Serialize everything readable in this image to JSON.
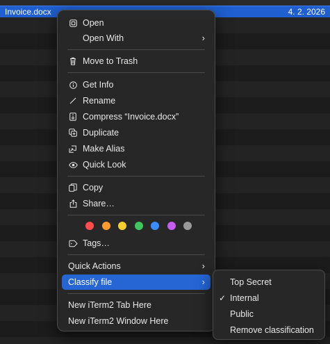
{
  "file_row": {
    "name": "Invoice.docx",
    "date": "4. 2. 2026"
  },
  "menu": {
    "open": "Open",
    "open_with": "Open With",
    "move_to_trash": "Move to Trash",
    "get_info": "Get Info",
    "rename": "Rename",
    "compress": "Compress “Invoice.docx”",
    "duplicate": "Duplicate",
    "make_alias": "Make Alias",
    "quick_look": "Quick Look",
    "copy": "Copy",
    "share": "Share…",
    "tags": "Tags…",
    "quick_actions": "Quick Actions",
    "classify_file": "Classify file",
    "new_iterm2_tab": "New iTerm2 Tab Here",
    "new_iterm2_window": "New iTerm2 Window Here"
  },
  "tag_colors": [
    "#ff4d4d",
    "#ff9a2e",
    "#f5cf2e",
    "#3ec55e",
    "#3a8dff",
    "#c65cf0",
    "#9a9a9a"
  ],
  "submenu": {
    "top_secret": "Top Secret",
    "internal": "Internal",
    "public": "Public",
    "remove_classification": "Remove classification",
    "checked": "Internal"
  }
}
